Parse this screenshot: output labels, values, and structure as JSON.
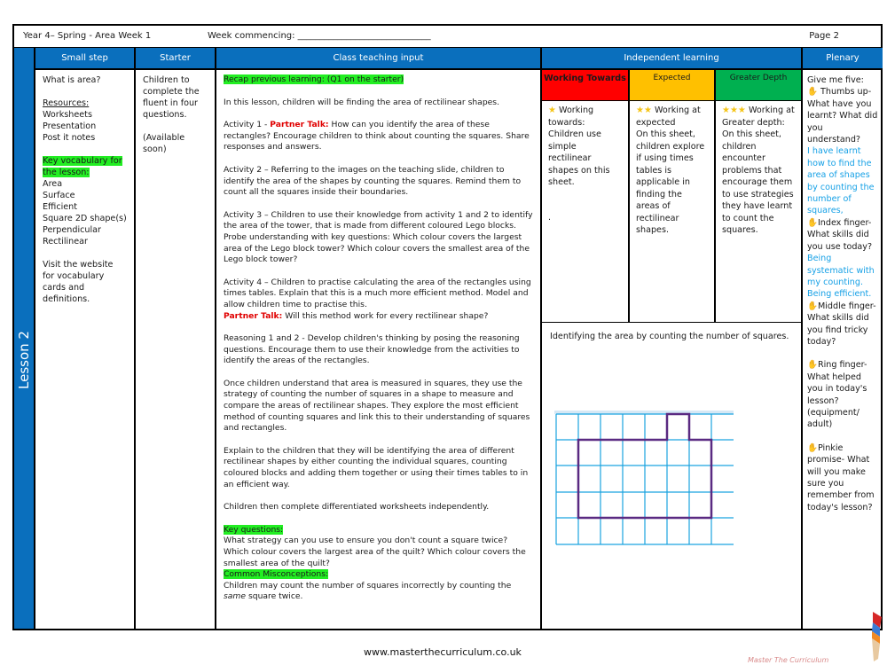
{
  "header": {
    "title": "Year 4– Spring - Area Week 1",
    "week_commencing": "Week commencing: ______________________________",
    "page": "Page 2"
  },
  "lesson_label": "Lesson 2",
  "columns": {
    "small_step": "Small step",
    "starter": "Starter",
    "class_teaching": "Class teaching input",
    "independent": "Independent learning",
    "plenary": "Plenary"
  },
  "small_step": {
    "question": "What is area?",
    "resources_label": "Resources:",
    "resources": [
      "Worksheets",
      "Presentation",
      "Post it notes"
    ],
    "vocab_label": "Key vocabulary for the lesson:",
    "vocab": [
      "Area",
      "Surface",
      "Efficient",
      "Square 2D shape(s)",
      "Perpendicular",
      "Rectilinear"
    ],
    "website_note": "Visit the website for vocabulary cards and definitions."
  },
  "starter": {
    "text": "Children to complete the fluent in four questions.",
    "note": "(Available soon)"
  },
  "class_teaching": {
    "recap": "Recap previous learning: (Q1 on the starter)",
    "intro": "In this lesson, children will be finding the area of rectilinear shapes.",
    "activity1_prefix": "Activity 1 - ",
    "partner_talk": "Partner Talk:",
    "activity1_text": " How can you identify the area of these rectangles? Encourage children to think about counting the squares. Share responses and answers.",
    "activity2": "Activity 2 – Referring to the images on the teaching slide, children to identify the area of the shapes by counting the squares. Remind them to count all the squares inside their boundaries.",
    "activity3": "Activity 3 – Children to use their knowledge from activity 1 and 2 to identify the area of the tower, that is made from different coloured Lego blocks. Probe understanding with key questions: Which colour covers the largest area of the Lego block tower? Which colour covers the smallest area of the Lego block tower?",
    "activity4": "Activity 4 – Children to practise calculating the area of the rectangles using times tables. Explain that this is a much more efficient method. Model and allow children time to practise this.",
    "activity4_partner_text": " Will this method work for every rectilinear shape?",
    "reasoning": "Reasoning 1 and 2 - Develop children's thinking by posing the reasoning questions. Encourage them to use their knowledge from the activities to identify the areas of the rectangles.",
    "once": "Once children understand that area is measured in squares, they use the strategy of counting the number of squares in a shape to measure and compare the areas of rectilinear shapes. They explore the most efficient method of counting squares and link this to their understanding of squares and rectangles.",
    "explain": "Explain to the children that they will be identifying the area of different rectilinear shapes by either counting the individual squares, counting coloured blocks and adding them together or using their times tables to in an efficient way.",
    "worksheets": "Children then complete differentiated worksheets independently.",
    "key_questions_label": "Key questions:",
    "key_questions": "What strategy can you use to ensure you don't count a square twice? Which colour covers the largest area of the quilt? Which colour covers the smallest area of the quilt?",
    "misconceptions_label": "Common Misconceptions:",
    "misconceptions_pre": "Children may count the number of squares incorrectly by counting the ",
    "misconceptions_em": "same",
    "misconceptions_post": " square twice."
  },
  "independent": {
    "levels": [
      {
        "label": "Working Towards",
        "color": "#ff0000",
        "stars": "★",
        "text_lead": " Working towards:",
        "text": "Children use simple rectilinear shapes on this sheet.",
        "extra": "."
      },
      {
        "label": "Expected",
        "color": "#ffc000",
        "stars": "★★",
        "text_lead": " Working at expected",
        "text": "On this sheet, children explore if using times tables is applicable in finding the areas of rectilinear shapes.",
        "extra": ""
      },
      {
        "label": "Greater Depth",
        "color": "#00b050",
        "stars": "★★★",
        "text_lead": " Working at Greater depth:",
        "text": "On this sheet, children encounter problems that encourage them to use strategies they have learnt to count the squares.",
        "extra": ""
      }
    ],
    "example_caption": "Identifying the area by counting the number of squares."
  },
  "plenary": {
    "intro": "Give me five:",
    "thumb": "Thumbs up- What have you learnt? What did you understand?",
    "thumb_answer": "I have learnt how to find the area of shapes by counting the number of squares,",
    "index": "Index finger- What skills did you use today?",
    "index_answer1": "Being systematic with my counting.",
    "index_answer2": "Being efficient.",
    "middle": "Middle finger- What skills did you find tricky today?",
    "ring": "Ring finger- What helped you in today's lesson? (equipment/ adult)",
    "pinkie": "Pinkie promise- What will you make sure you remember from today's lesson?",
    "hand_glyph": "✋"
  },
  "footer": {
    "url": "www.masterthecurriculum.co.uk",
    "logo_text": "Master The Curriculum"
  },
  "colors": {
    "header_blue": "#0a6fbd",
    "highlight_green": "#22ee22",
    "partner_red": "#e00000",
    "answer_blue": "#17a1e6",
    "grid_blue": "#1aa3e0",
    "shape_purple": "#5a2a82"
  }
}
